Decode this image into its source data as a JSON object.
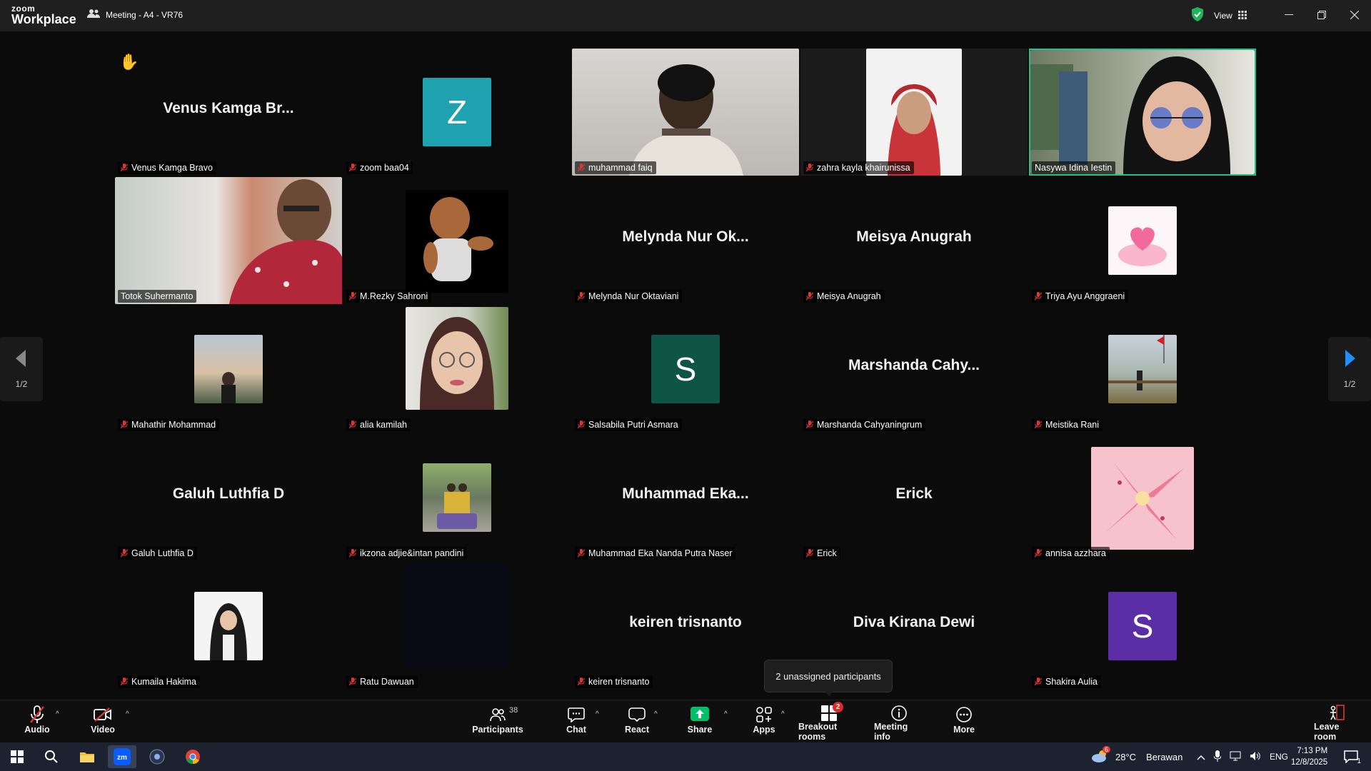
{
  "app": {
    "logo_line1": "zoom",
    "logo_line2": "Workplace",
    "meeting_title": "Meeting - A4 - VR76",
    "view_label": "View"
  },
  "participants": [
    {
      "name": "Venus Kamga Bravo",
      "display_big": "Venus Kamga Br...",
      "muted": true,
      "raised_hand": true
    },
    {
      "name": "zoom baa04",
      "avatar_letter": "Z",
      "avatar_color": "#1fa2b0",
      "muted": true
    },
    {
      "name": "muhammad faiq",
      "muted": true
    },
    {
      "name": "zahra kayla khairunissa",
      "muted": true
    },
    {
      "name": "Nasywa Idina Iestin",
      "muted": false,
      "active_speaker": true
    },
    {
      "name": "Totok Suhermanto",
      "muted": false
    },
    {
      "name": "M.Rezky Sahroni",
      "muted": true
    },
    {
      "name": "Melynda Nur Oktaviani",
      "display_big": "Melynda Nur Ok...",
      "muted": true
    },
    {
      "name": "Meisya Anugrah",
      "display_big": "Meisya Anugrah",
      "muted": true
    },
    {
      "name": "Triya Ayu Anggraeni",
      "muted": true
    },
    {
      "name": "Mahathir Mohammad",
      "muted": true
    },
    {
      "name": "alia kamilah",
      "muted": true
    },
    {
      "name": "Salsabila Putri Asmara",
      "avatar_letter": "S",
      "avatar_color": "#0e5545",
      "muted": true
    },
    {
      "name": "Marshanda Cahyaningrum",
      "display_big": "Marshanda  Cahy...",
      "muted": true
    },
    {
      "name": "Meistika Rani",
      "muted": true
    },
    {
      "name": "Galuh Luthfia D",
      "display_big": "Galuh Luthfia D",
      "muted": true
    },
    {
      "name": "ikzona adjie&intan pandini",
      "muted": true
    },
    {
      "name": "Muhammad Eka Nanda Putra Naser",
      "display_big": "Muhammad  Eka...",
      "muted": true
    },
    {
      "name": "Erick",
      "display_big": "Erick",
      "muted": true
    },
    {
      "name": "annisa azzhara",
      "muted": true
    },
    {
      "name": "Kumaila Hakima",
      "muted": true
    },
    {
      "name": "Ratu Dawuan",
      "muted": true
    },
    {
      "name": "keiren trisnanto",
      "display_big": "keiren trisnanto",
      "muted": true
    },
    {
      "name": "Diva Kirana Dewi",
      "display_big": "Diva Kirana Dewi"
    },
    {
      "name": "Shakira Aulia",
      "avatar_letter": "S",
      "avatar_color": "#5b2ea6",
      "muted": true
    }
  ],
  "pagination": {
    "left": "1/2",
    "right": "1/2"
  },
  "tooltip": "2 unassigned participants",
  "toolbar": {
    "audio": "Audio",
    "video": "Video",
    "participants": "Participants",
    "participants_count": "38",
    "chat": "Chat",
    "react": "React",
    "share": "Share",
    "apps": "Apps",
    "breakout": "Breakout rooms",
    "breakout_badge": "2",
    "meeting_info": "Meeting info",
    "more": "More",
    "leave": "Leave room"
  },
  "taskbar": {
    "weather_temp": "28°C",
    "weather_desc": "Berawan",
    "weather_badge": "6",
    "lang": "ENG",
    "time": "7:13 PM",
    "date": "12/8/2025",
    "notif_count": "1"
  },
  "colors": {
    "active_border": "#22c08b",
    "accent": "#0b5cff",
    "share_green": "#00c16a"
  }
}
